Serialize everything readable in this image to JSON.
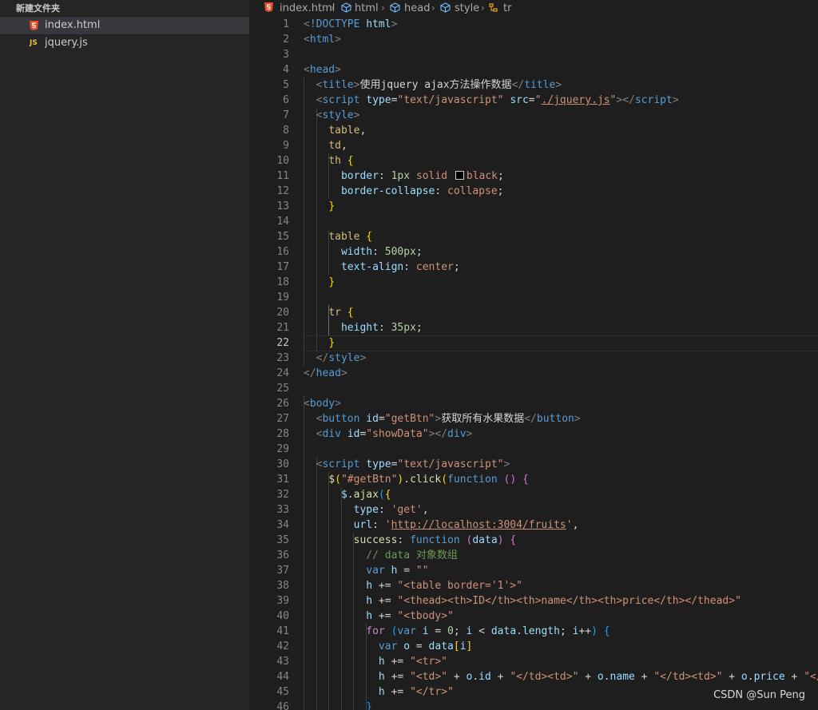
{
  "sidebar": {
    "folder_name": "新建文件夹",
    "files": [
      {
        "name": "index.html",
        "icon": "html5-icon",
        "active": true
      },
      {
        "name": "jquery.js",
        "icon": "js-icon",
        "active": false
      }
    ]
  },
  "breadcrumb": [
    {
      "label": "index.html",
      "icon": "html5-icon"
    },
    {
      "label": "html",
      "icon": "symbol-element-icon"
    },
    {
      "label": "head",
      "icon": "symbol-element-icon"
    },
    {
      "label": "style",
      "icon": "symbol-element-icon"
    },
    {
      "label": "tr",
      "icon": "symbol-rule-icon"
    }
  ],
  "editor": {
    "current_line": 22,
    "lines": [
      [
        [
          "p",
          "<"
        ],
        [
          "tg",
          "!DOCTYPE"
        ],
        [
          "tx",
          " "
        ],
        [
          "at",
          "html"
        ],
        [
          "p",
          ">"
        ]
      ],
      [
        [
          "p",
          "<"
        ],
        [
          "tg",
          "html"
        ],
        [
          "p",
          ">"
        ]
      ],
      [],
      [
        [
          "p",
          "<"
        ],
        [
          "tg",
          "head"
        ],
        [
          "p",
          ">"
        ]
      ],
      [
        [
          "tx",
          "  "
        ],
        [
          "p",
          "<"
        ],
        [
          "tg",
          "title"
        ],
        [
          "p",
          ">"
        ],
        [
          "tx",
          "使用jquery ajax方法操作数据"
        ],
        [
          "p",
          "</"
        ],
        [
          "tg",
          "title"
        ],
        [
          "p",
          ">"
        ]
      ],
      [
        [
          "tx",
          "  "
        ],
        [
          "p",
          "<"
        ],
        [
          "tg",
          "script"
        ],
        [
          "tx",
          " "
        ],
        [
          "at",
          "type"
        ],
        [
          "tx",
          "="
        ],
        [
          "s",
          "\"text/javascript\""
        ],
        [
          "tx",
          " "
        ],
        [
          "at",
          "src"
        ],
        [
          "tx",
          "="
        ],
        [
          "s",
          "\""
        ],
        [
          "su",
          "./jquery.js"
        ],
        [
          "s",
          "\""
        ],
        [
          "p",
          "></"
        ],
        [
          "tg",
          "script"
        ],
        [
          "p",
          ">"
        ]
      ],
      [
        [
          "tx",
          "  "
        ],
        [
          "p",
          "<"
        ],
        [
          "tg",
          "style"
        ],
        [
          "p",
          ">"
        ]
      ],
      [
        [
          "tx",
          "    "
        ],
        [
          "sl",
          "table"
        ],
        [
          "tx",
          ","
        ]
      ],
      [
        [
          "tx",
          "    "
        ],
        [
          "sl",
          "td"
        ],
        [
          "tx",
          ","
        ]
      ],
      [
        [
          "tx",
          "    "
        ],
        [
          "sl",
          "th"
        ],
        [
          "tx",
          " "
        ],
        [
          "b1",
          "{"
        ]
      ],
      [
        [
          "tx",
          "      "
        ],
        [
          "pr",
          "border"
        ],
        [
          "tx",
          ": "
        ],
        [
          "n",
          "1px"
        ],
        [
          "tx",
          " "
        ],
        [
          "s",
          "solid"
        ],
        [
          "tx",
          " "
        ],
        [
          "sw",
          ""
        ],
        [
          "s",
          "black"
        ],
        [
          "tx",
          ";"
        ]
      ],
      [
        [
          "tx",
          "      "
        ],
        [
          "pr",
          "border-collapse"
        ],
        [
          "tx",
          ": "
        ],
        [
          "s",
          "collapse"
        ],
        [
          "tx",
          ";"
        ]
      ],
      [
        [
          "tx",
          "    "
        ],
        [
          "b1",
          "}"
        ]
      ],
      [],
      [
        [
          "tx",
          "    "
        ],
        [
          "sl",
          "table"
        ],
        [
          "tx",
          " "
        ],
        [
          "b1",
          "{"
        ]
      ],
      [
        [
          "tx",
          "      "
        ],
        [
          "pr",
          "width"
        ],
        [
          "tx",
          ": "
        ],
        [
          "n",
          "500px"
        ],
        [
          "tx",
          ";"
        ]
      ],
      [
        [
          "tx",
          "      "
        ],
        [
          "pr",
          "text-align"
        ],
        [
          "tx",
          ": "
        ],
        [
          "s",
          "center"
        ],
        [
          "tx",
          ";"
        ]
      ],
      [
        [
          "tx",
          "    "
        ],
        [
          "b1",
          "}"
        ]
      ],
      [],
      [
        [
          "tx",
          "    "
        ],
        [
          "sl",
          "tr"
        ],
        [
          "tx",
          " "
        ],
        [
          "b1",
          "{"
        ]
      ],
      [
        [
          "tx",
          "      "
        ],
        [
          "pr",
          "height"
        ],
        [
          "tx",
          ": "
        ],
        [
          "n",
          "35px"
        ],
        [
          "tx",
          ";"
        ]
      ],
      [
        [
          "tx",
          "    "
        ],
        [
          "b1",
          "}"
        ]
      ],
      [
        [
          "tx",
          "  "
        ],
        [
          "p",
          "</"
        ],
        [
          "tg",
          "style"
        ],
        [
          "p",
          ">"
        ]
      ],
      [
        [
          "p",
          "</"
        ],
        [
          "tg",
          "head"
        ],
        [
          "p",
          ">"
        ]
      ],
      [],
      [
        [
          "p",
          "<"
        ],
        [
          "tg",
          "body"
        ],
        [
          "p",
          ">"
        ]
      ],
      [
        [
          "tx",
          "  "
        ],
        [
          "p",
          "<"
        ],
        [
          "tg",
          "button"
        ],
        [
          "tx",
          " "
        ],
        [
          "at",
          "id"
        ],
        [
          "tx",
          "="
        ],
        [
          "s",
          "\"getBtn\""
        ],
        [
          "p",
          ">"
        ],
        [
          "tx",
          "获取所有水果数据"
        ],
        [
          "p",
          "</"
        ],
        [
          "tg",
          "button"
        ],
        [
          "p",
          ">"
        ]
      ],
      [
        [
          "tx",
          "  "
        ],
        [
          "p",
          "<"
        ],
        [
          "tg",
          "div"
        ],
        [
          "tx",
          " "
        ],
        [
          "at",
          "id"
        ],
        [
          "tx",
          "="
        ],
        [
          "s",
          "\"showData\""
        ],
        [
          "p",
          "></"
        ],
        [
          "tg",
          "div"
        ],
        [
          "p",
          ">"
        ]
      ],
      [],
      [
        [
          "tx",
          "  "
        ],
        [
          "p",
          "<"
        ],
        [
          "tg",
          "script"
        ],
        [
          "tx",
          " "
        ],
        [
          "at",
          "type"
        ],
        [
          "tx",
          "="
        ],
        [
          "s",
          "\"text/javascript\""
        ],
        [
          "p",
          ">"
        ]
      ],
      [
        [
          "tx",
          "    "
        ],
        [
          "f",
          "$"
        ],
        [
          "b1",
          "("
        ],
        [
          "s",
          "\"#getBtn\""
        ],
        [
          "b1",
          ")"
        ],
        [
          "tx",
          "."
        ],
        [
          "f",
          "click"
        ],
        [
          "b1",
          "("
        ],
        [
          "k",
          "function"
        ],
        [
          "tx",
          " "
        ],
        [
          "b2",
          "()"
        ],
        [
          "tx",
          " "
        ],
        [
          "b2",
          "{"
        ]
      ],
      [
        [
          "tx",
          "      "
        ],
        [
          "v",
          "$"
        ],
        [
          "tx",
          "."
        ],
        [
          "f",
          "ajax"
        ],
        [
          "b3",
          "("
        ],
        [
          "b1",
          "{"
        ]
      ],
      [
        [
          "tx",
          "        "
        ],
        [
          "v",
          "type"
        ],
        [
          "tx",
          ": "
        ],
        [
          "s",
          "'get'"
        ],
        [
          "tx",
          ","
        ]
      ],
      [
        [
          "tx",
          "        "
        ],
        [
          "v",
          "url"
        ],
        [
          "tx",
          ": "
        ],
        [
          "s",
          "'"
        ],
        [
          "su",
          "http://localhost:3004/fruits"
        ],
        [
          "s",
          "'"
        ],
        [
          "tx",
          ","
        ]
      ],
      [
        [
          "tx",
          "        "
        ],
        [
          "f",
          "success"
        ],
        [
          "tx",
          ": "
        ],
        [
          "k",
          "function"
        ],
        [
          "tx",
          " "
        ],
        [
          "b2",
          "("
        ],
        [
          "v",
          "data"
        ],
        [
          "b2",
          ")"
        ],
        [
          "tx",
          " "
        ],
        [
          "b2",
          "{"
        ]
      ],
      [
        [
          "tx",
          "          "
        ],
        [
          "c",
          "// data 对象数组"
        ]
      ],
      [
        [
          "tx",
          "          "
        ],
        [
          "k",
          "var"
        ],
        [
          "tx",
          " "
        ],
        [
          "v",
          "h"
        ],
        [
          "tx",
          " = "
        ],
        [
          "s",
          "\"\""
        ]
      ],
      [
        [
          "tx",
          "          "
        ],
        [
          "v",
          "h"
        ],
        [
          "tx",
          " += "
        ],
        [
          "s",
          "\"<table border='1'>\""
        ]
      ],
      [
        [
          "tx",
          "          "
        ],
        [
          "v",
          "h"
        ],
        [
          "tx",
          " += "
        ],
        [
          "s",
          "\"<thead><th>ID</th><th>name</th><th>price</th></thead>\""
        ]
      ],
      [
        [
          "tx",
          "          "
        ],
        [
          "v",
          "h"
        ],
        [
          "tx",
          " += "
        ],
        [
          "s",
          "\"<tbody>\""
        ]
      ],
      [
        [
          "tx",
          "          "
        ],
        [
          "ct",
          "for"
        ],
        [
          "tx",
          " "
        ],
        [
          "b3",
          "("
        ],
        [
          "k",
          "var"
        ],
        [
          "tx",
          " "
        ],
        [
          "v",
          "i"
        ],
        [
          "tx",
          " = "
        ],
        [
          "n",
          "0"
        ],
        [
          "tx",
          "; "
        ],
        [
          "v",
          "i"
        ],
        [
          "tx",
          " < "
        ],
        [
          "v",
          "data"
        ],
        [
          "tx",
          "."
        ],
        [
          "v",
          "length"
        ],
        [
          "tx",
          "; "
        ],
        [
          "v",
          "i"
        ],
        [
          "tx",
          "++"
        ],
        [
          "b3",
          ")"
        ],
        [
          "tx",
          " "
        ],
        [
          "b3",
          "{"
        ]
      ],
      [
        [
          "tx",
          "            "
        ],
        [
          "k",
          "var"
        ],
        [
          "tx",
          " "
        ],
        [
          "v",
          "o"
        ],
        [
          "tx",
          " = "
        ],
        [
          "v",
          "data"
        ],
        [
          "b1",
          "["
        ],
        [
          "v",
          "i"
        ],
        [
          "b1",
          "]"
        ]
      ],
      [
        [
          "tx",
          "            "
        ],
        [
          "v",
          "h"
        ],
        [
          "tx",
          " += "
        ],
        [
          "s",
          "\"<tr>\""
        ]
      ],
      [
        [
          "tx",
          "            "
        ],
        [
          "v",
          "h"
        ],
        [
          "tx",
          " += "
        ],
        [
          "s",
          "\"<td>\""
        ],
        [
          "tx",
          " + "
        ],
        [
          "v",
          "o"
        ],
        [
          "tx",
          "."
        ],
        [
          "v",
          "id"
        ],
        [
          "tx",
          " + "
        ],
        [
          "s",
          "\"</td><td>\""
        ],
        [
          "tx",
          " + "
        ],
        [
          "v",
          "o"
        ],
        [
          "tx",
          "."
        ],
        [
          "v",
          "name"
        ],
        [
          "tx",
          " + "
        ],
        [
          "s",
          "\"</td><td>\""
        ],
        [
          "tx",
          " + "
        ],
        [
          "v",
          "o"
        ],
        [
          "tx",
          "."
        ],
        [
          "v",
          "price"
        ],
        [
          "tx",
          " + "
        ],
        [
          "s",
          "\"</td>\""
        ]
      ],
      [
        [
          "tx",
          "            "
        ],
        [
          "v",
          "h"
        ],
        [
          "tx",
          " += "
        ],
        [
          "s",
          "\"</tr>\""
        ]
      ],
      [
        [
          "tx",
          "          "
        ],
        [
          "b3",
          "}"
        ]
      ]
    ]
  },
  "watermark": "CSDN @Sun   Peng"
}
